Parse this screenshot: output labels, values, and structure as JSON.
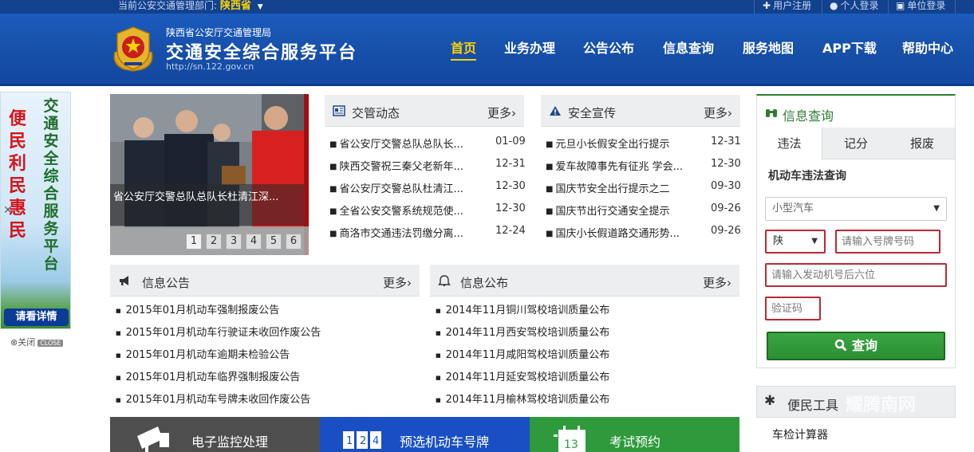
{
  "topbar": {
    "current_area_label": "当前公安交通管理部门:",
    "current_area_value": "陕西省",
    "links": [
      {
        "label": "用户注册",
        "icon": "user-plus-icon"
      },
      {
        "label": "个人登录",
        "icon": "user-icon"
      },
      {
        "label": "单位登录",
        "icon": "building-icon"
      }
    ]
  },
  "header": {
    "org": "陕西省公安厅交通管理局",
    "title": "交通安全综合服务平台",
    "url": "http://sn.122.gov.cn"
  },
  "nav": [
    "首页",
    "业务办理",
    "公告公布",
    "信息查询",
    "服务地图",
    "APP下载",
    "帮助中心"
  ],
  "side_ad": {
    "red_text": "便民利民惠民",
    "green_text": "交通安全综合服务平台",
    "button": "请看详情",
    "close_label": "关闭",
    "close_tag": "CLOSE"
  },
  "slider": {
    "caption": "省公安厅交警总队总队长杜清江深...",
    "dots": [
      "1",
      "2",
      "3",
      "4",
      "5",
      "6"
    ]
  },
  "traffic_news": {
    "title": "交管动态",
    "more": "更多",
    "items": [
      {
        "text": "省公安厅交警总队总队长...",
        "date": "01-09"
      },
      {
        "text": "陕西交警祝三秦父老新年...",
        "date": "12-31"
      },
      {
        "text": "省公安厅交警总队杜清江...",
        "date": "12-30"
      },
      {
        "text": "全省公安交警系统规范使...",
        "date": "12-30"
      },
      {
        "text": "商洛市交通违法罚缴分离...",
        "date": "12-24"
      }
    ]
  },
  "safety": {
    "title": "安全宣传",
    "more": "更多",
    "items": [
      {
        "text": "元旦小长假安全出行提示",
        "date": "12-31"
      },
      {
        "text": "爱车故障事先有征兆 学会...",
        "date": "12-30"
      },
      {
        "text": "国庆节安全出行提示之二",
        "date": "09-30"
      },
      {
        "text": "国庆节出行交通安全提示",
        "date": "09-26"
      },
      {
        "text": "国庆小长假道路交通形势...",
        "date": "09-26"
      }
    ]
  },
  "notice": {
    "title": "信息公告",
    "more": "更多",
    "items": [
      "2015年01月机动车强制报废公告",
      "2015年01月机动车行驶证未收回作废公告",
      "2015年01月机动车逾期未检验公告",
      "2015年01月机动车临界强制报废公告",
      "2015年01月机动车号牌未收回作废公告"
    ]
  },
  "publish": {
    "title": "信息公布",
    "more": "更多",
    "items": [
      "2014年11月铜川驾校培训质量公布",
      "2014年11月西安驾校培训质量公布",
      "2014年11月咸阳驾校培训质量公布",
      "2014年11月延安驾校培训质量公布",
      "2014年11月榆林驾校培训质量公布"
    ]
  },
  "query": {
    "title": "信息查询",
    "tabs": [
      "违法",
      "记分",
      "报废"
    ],
    "form_title": "机动车违法查询",
    "vehicle_type": "小型汽车",
    "plate_prefix": "陕",
    "plate_placeholder": "请输入号牌号码",
    "engine_placeholder": "请输入发动机号后六位",
    "captcha_placeholder": "验证码",
    "submit": "查询"
  },
  "tools": {
    "title": "便民工具",
    "watermark": "耀腾南网",
    "items": [
      "车检计算器"
    ]
  },
  "features": [
    {
      "label": "电子监控处理",
      "color": "#4e4e4e"
    },
    {
      "label": "预选机动车号牌",
      "color": "#1a4fc4"
    },
    {
      "label": "考试预约",
      "color": "#2e9a3c"
    }
  ]
}
